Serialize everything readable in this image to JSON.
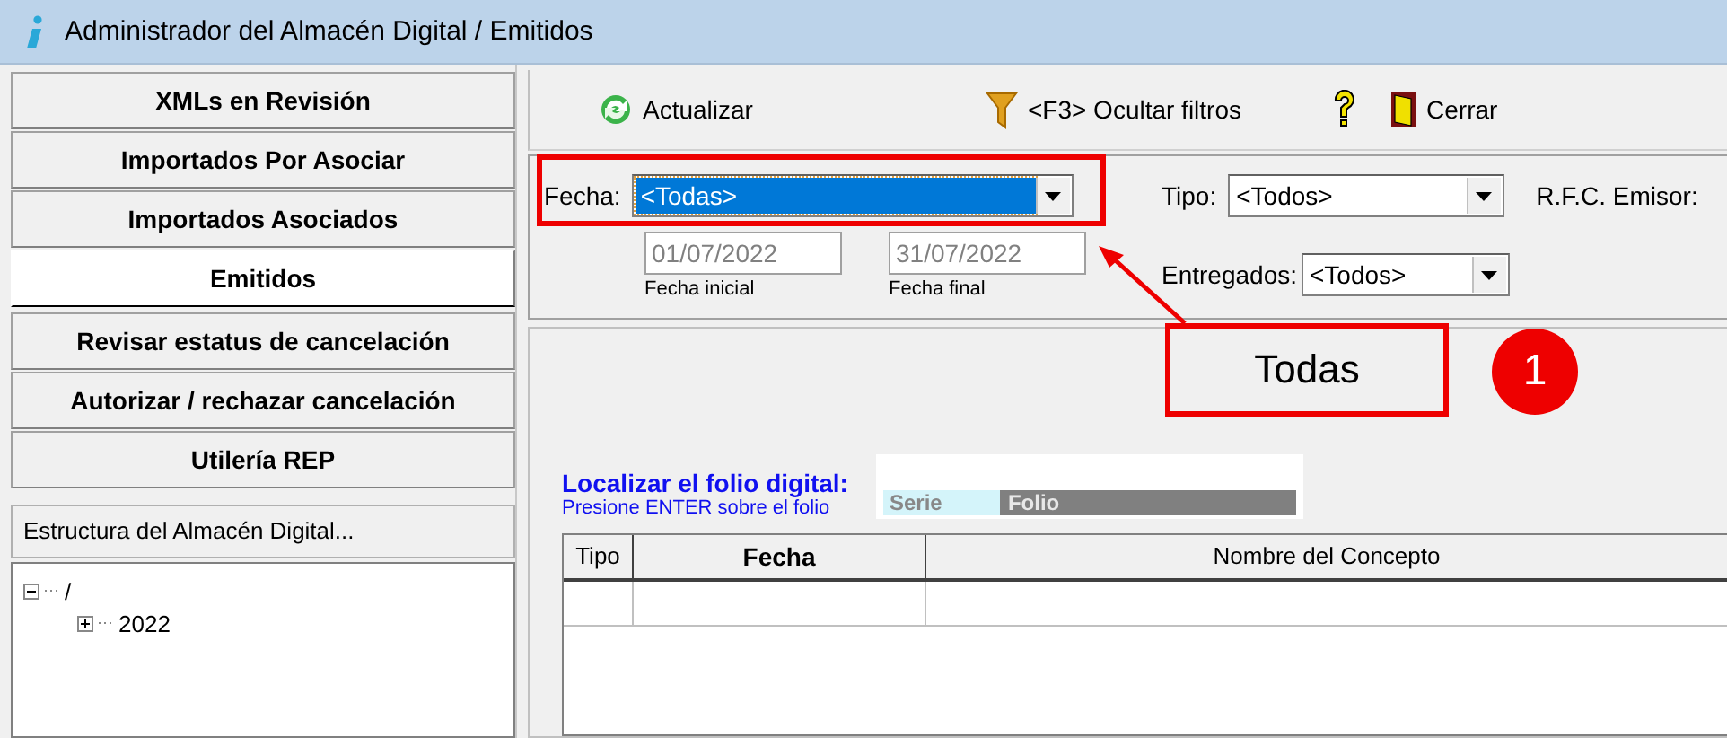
{
  "window": {
    "title": "Administrador del Almacén Digital / Emitidos"
  },
  "sidebar": {
    "items": [
      {
        "label": "XMLs en Revisión",
        "selected": false
      },
      {
        "label": "Importados Por Asociar",
        "selected": false
      },
      {
        "label": "Importados Asociados",
        "selected": false
      },
      {
        "label": "Emitidos",
        "selected": true
      },
      {
        "label": "Revisar estatus de cancelación",
        "selected": false
      },
      {
        "label": "Autorizar / rechazar cancelación",
        "selected": false
      },
      {
        "label": "Utilería REP",
        "selected": false
      }
    ],
    "tree_header": "Estructura del Almacén Digital...",
    "tree": [
      {
        "label": "/",
        "expanded": true,
        "children": [
          {
            "label": "2022",
            "expanded": false
          }
        ]
      }
    ]
  },
  "toolbar": [
    {
      "kind": "refresh",
      "label": "Actualizar"
    },
    {
      "kind": "filter",
      "label": "<F3> Ocultar filtros"
    },
    {
      "kind": "help"
    },
    {
      "kind": "door",
      "label": "Cerrar"
    }
  ],
  "filters": {
    "fecha": {
      "label": "Fecha:",
      "value": "<Todas>",
      "focused": true
    },
    "fecha_inicial": {
      "value": "01/07/2022",
      "caption": "Fecha inicial"
    },
    "fecha_final": {
      "value": "31/07/2022",
      "caption": "Fecha final"
    },
    "tipo": {
      "label": "Tipo:",
      "value": "<Todos>"
    },
    "rfc_emisor": {
      "label": "R.F.C. Emisor:"
    },
    "entregados": {
      "label": "Entregados:",
      "value": "<Todos>"
    }
  },
  "search": {
    "title": "Localizar el folio digital:",
    "hint": "Presione ENTER sobre el folio",
    "serie_label": "Serie",
    "folio_label": "Folio"
  },
  "table": {
    "columns": [
      {
        "label": "Tipo",
        "bold": false
      },
      {
        "label": "Fecha",
        "bold": true
      },
      {
        "label": "Nombre del Concepto",
        "bold": false
      }
    ]
  },
  "annotation": {
    "callout": "Todas",
    "step": "1"
  }
}
